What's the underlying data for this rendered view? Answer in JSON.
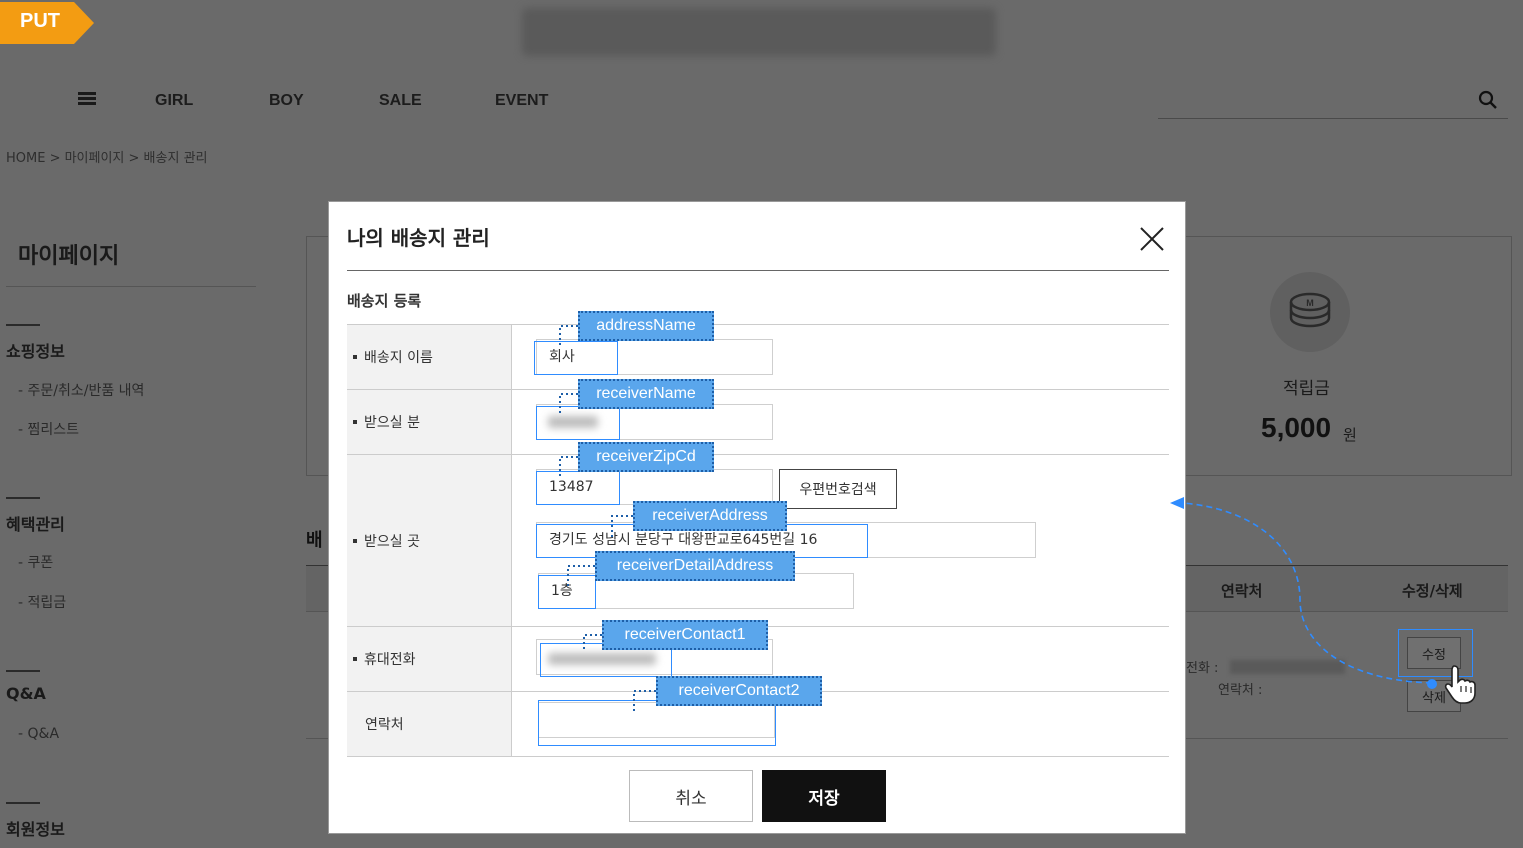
{
  "badge": {
    "label": "PUT",
    "color": "#f39c12"
  },
  "nav": {
    "items": [
      "GIRL",
      "BOY",
      "SALE",
      "EVENT"
    ]
  },
  "breadcrumb": "HOME > 마이페이지 > 배송지 관리",
  "sidebar": {
    "title": "마이페이지",
    "sections": [
      {
        "title": "쇼핑정보",
        "items": [
          "- 주문/취소/반품 내역",
          "- 찜리스트"
        ]
      },
      {
        "title": "혜택관리",
        "items": [
          "- 쿠폰",
          "- 적립금"
        ]
      },
      {
        "title": "Q&A",
        "items": [
          "- Q&A"
        ]
      },
      {
        "title": "회원정보",
        "items": []
      }
    ]
  },
  "summary": {
    "points_label": "적립금",
    "points_value": "5,000",
    "points_unit": "원"
  },
  "background_table": {
    "partial_heading": "배",
    "col_contact": "연락처",
    "col_edit": "수정/삭제",
    "row_phone_label": "전화 :",
    "row_contact_label": "연락처 :",
    "edit_button": "수정",
    "delete_button": "삭제"
  },
  "modal": {
    "title": "나의 배송지 관리",
    "section_title": "배송지 등록",
    "fields": {
      "address_name_label": "배송지 이름",
      "address_name_value": "회사",
      "receiver_name_label": "받으실 분",
      "receiver_place_label": "받으실 곳",
      "zip_value": "13487",
      "zip_search_button": "우편번호검색",
      "address_value": "경기도 성남시 분당구 대왕판교로645번길 16",
      "detail_address_value": "1층",
      "mobile_label": "휴대전화",
      "contact_label": "연락처"
    },
    "cancel_button": "취소",
    "save_button": "저장"
  },
  "annotations": {
    "address_name": "addressName",
    "receiver_name": "receiverName",
    "receiver_zip": "receiverZipCd",
    "receiver_address": "receiverAddress",
    "receiver_detail_address": "receiverDetailAddress",
    "receiver_contact1": "receiverContact1",
    "receiver_contact2": "receiverContact2"
  },
  "colors": {
    "annotation_tag": "#5aa6ec",
    "highlight_border": "#2f8cff",
    "save_button": "#111111",
    "dim_background": "#6b6b6b"
  }
}
